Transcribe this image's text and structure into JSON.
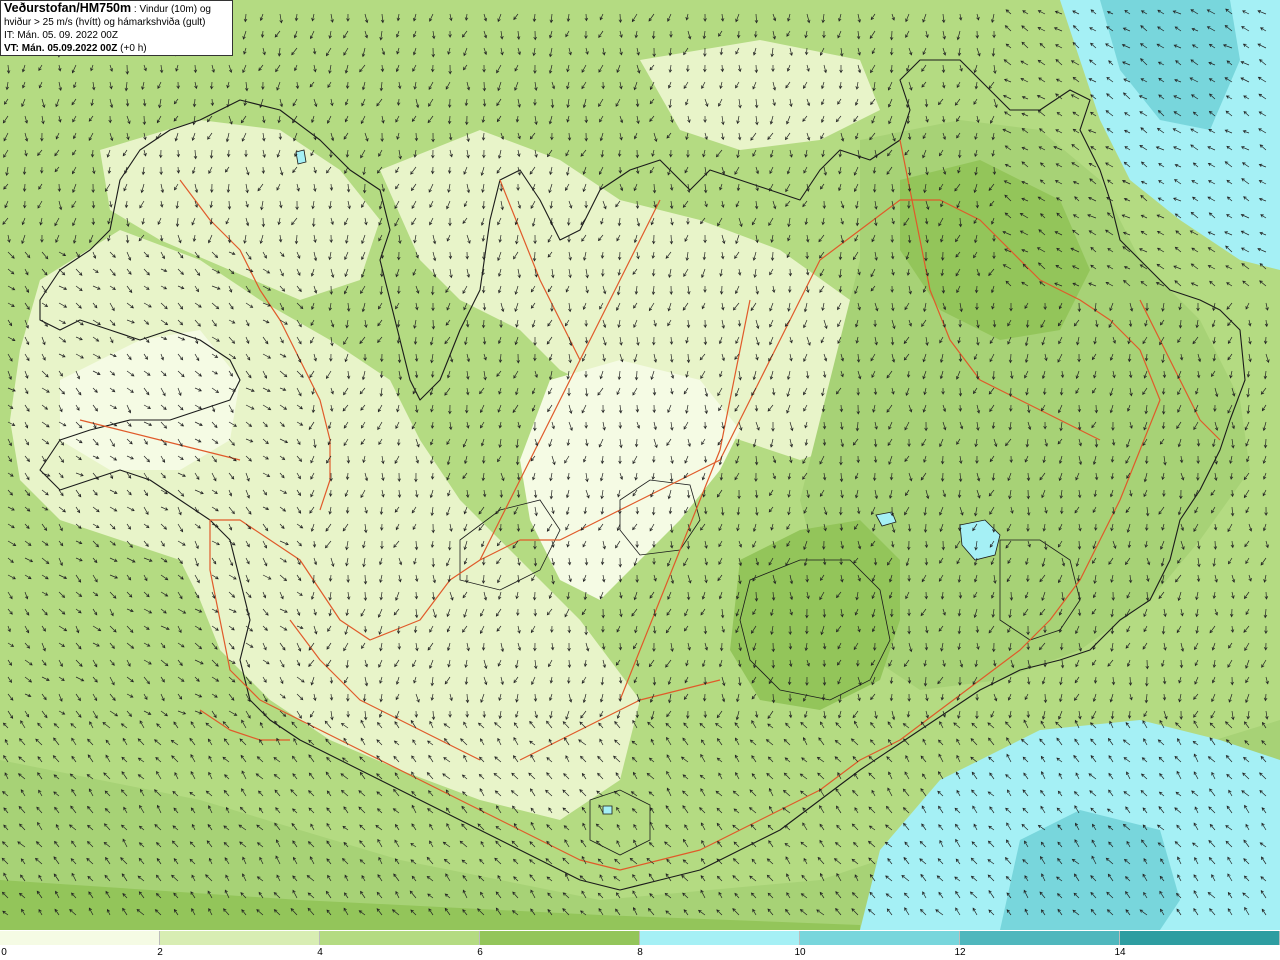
{
  "header": {
    "title": "Veðurstofan/HM750m",
    "title_suffix": " : Vindur (10m) og",
    "line2": "hviður > 25 m/s (hvítt) og hámarkshviða (gult)",
    "line3": "IT: Mán. 05. 09. 2022 00Z",
    "line4_bold": "VT: Mán. 05.09.2022 00Z",
    "line4_rest": " (+0 h)"
  },
  "legend": {
    "colors": [
      "#f5fbe4",
      "#d8edb3",
      "#b4db82",
      "#93c55a",
      "#a5f0f5",
      "#78d6dc",
      "#4fb7bd",
      "#2e9da1"
    ],
    "labels": [
      "0",
      "2",
      "4",
      "6",
      "8",
      "10",
      "12",
      "14"
    ]
  },
  "map": {
    "wind_arrow_color": "#222222",
    "coast_color": "#1a1a1a",
    "road_color": "#e05a2a",
    "lake_color": "#a5f0f5"
  }
}
